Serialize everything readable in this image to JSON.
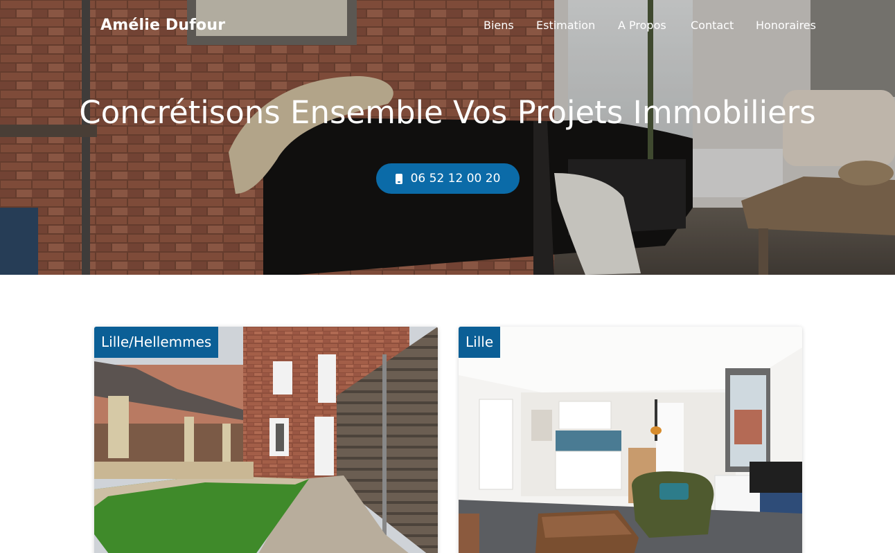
{
  "header": {
    "brand": "Amélie Dufour",
    "nav": [
      "Biens",
      "Estimation",
      "A Propos",
      "Contact",
      "Honoraires"
    ]
  },
  "hero": {
    "title": "Concrétisons Ensemble Vos Projets Immobiliers",
    "phone": "06 52 12 00 20",
    "phone_icon": "mobile-phone-icon"
  },
  "listings": [
    {
      "location": "Lille/Hellemmes"
    },
    {
      "location": "Lille"
    }
  ],
  "colors": {
    "accent": "#0b6ba8",
    "tag": "#0b5f96"
  }
}
